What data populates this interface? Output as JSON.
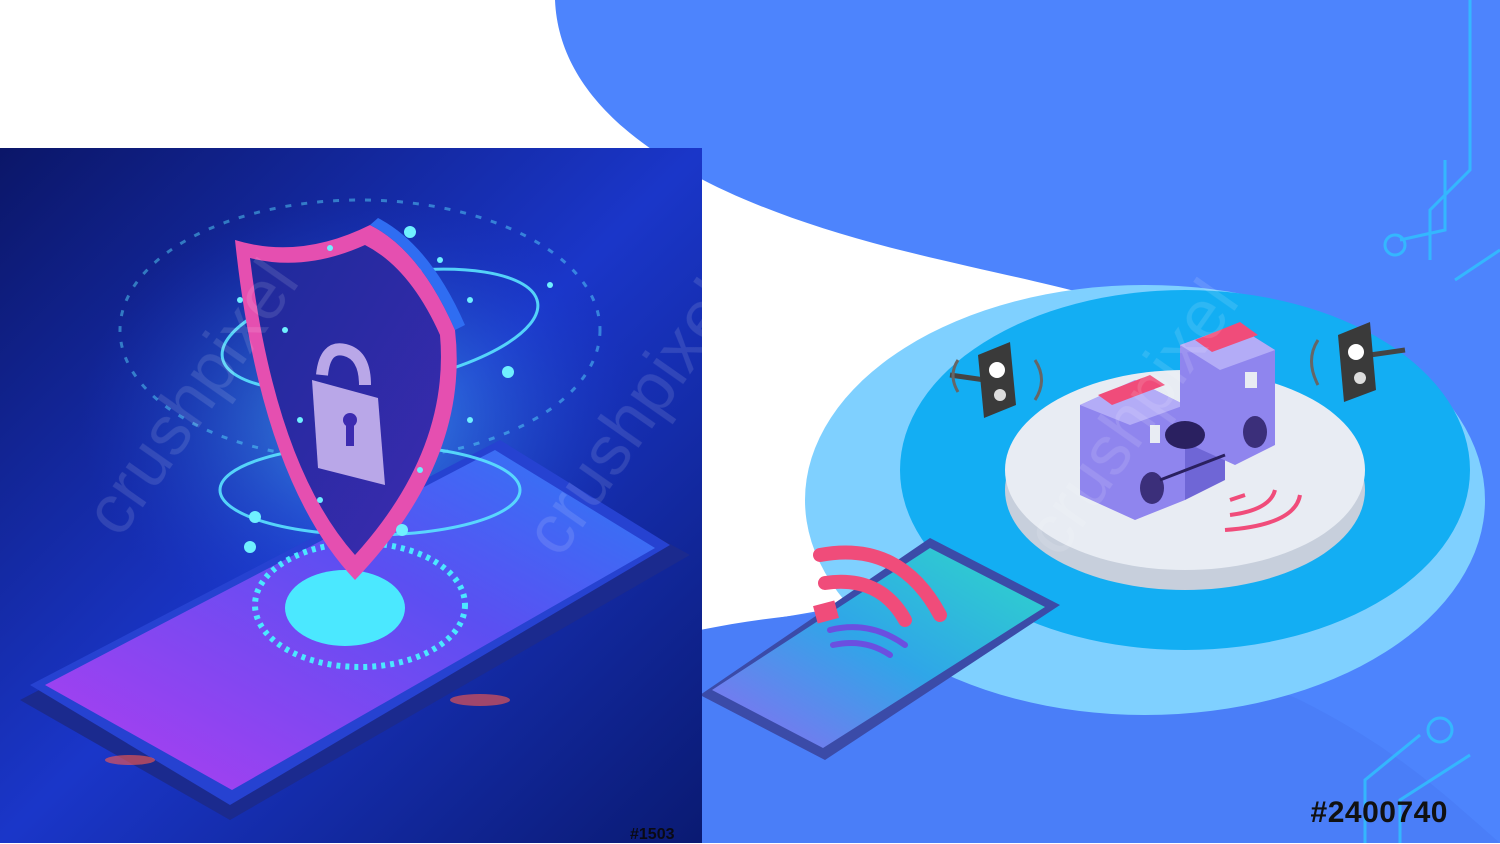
{
  "left_panel": {
    "subject": "shield-lock-over-smartphone",
    "stock_id": "#1503",
    "colors": {
      "bg_dark": "#081257",
      "bg_mid": "#1f3fd4",
      "glow": "#38d6ff",
      "shield_pink": "#e54fb0",
      "phone_purple": "#8a3df0"
    }
  },
  "right_panel": {
    "subject": "wireless-speaker-system-with-tablet",
    "stock_id": "#2400740",
    "colors": {
      "bg_blue": "#4d84fd",
      "ring_light": "#7fd0ff",
      "ring_cyan": "#13aef3",
      "platform": "#e8ecf3",
      "speaker_purple": "#8f85ee",
      "accent_pink": "#f04c7a",
      "tablet_teal": "#2fd7c9"
    }
  },
  "watermark": {
    "brand": "crushpixel"
  }
}
